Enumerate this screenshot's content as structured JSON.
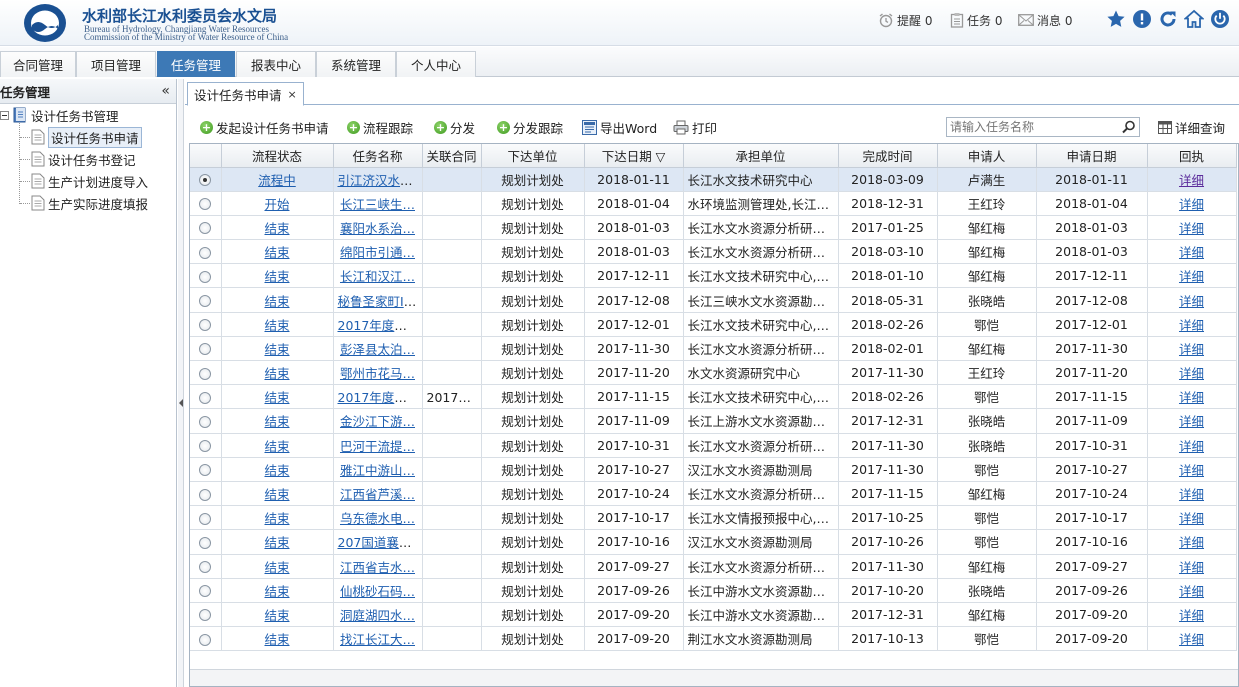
{
  "header": {
    "org_cn": "水利部长江水利委员会水文局",
    "org_en1": "Bureau  of  Hydrology,  Changjiang  Water  Resources",
    "org_en2": "Commission of the Ministry of Water Resource of China",
    "reminder_label": "提醒 0",
    "task_label": "任务 0",
    "message_label": "消息 0"
  },
  "menu": {
    "items": [
      "合同管理",
      "项目管理",
      "任务管理",
      "报表中心",
      "系统管理",
      "个人中心"
    ],
    "active": "任务管理"
  },
  "sidebar": {
    "title": "任务管理",
    "collapse_glyph": "«",
    "root": "设计任务书管理",
    "children": [
      "设计任务书申请",
      "设计任务书登记",
      "生产计划进度导入",
      "生产实际进度填报"
    ],
    "selected": "设计任务书申请"
  },
  "tab": {
    "label": "设计任务书申请",
    "close": "×"
  },
  "toolbar": {
    "start_label": "发起设计任务书申请",
    "track_label": "流程跟踪",
    "dispatch_label": "分发",
    "dispatch_track_label": "分发跟踪",
    "export_label": "导出Word",
    "print_label": "打印",
    "search_placeholder": "请输入任务名称",
    "detail_query_label": "详细查询"
  },
  "grid": {
    "columns": [
      "",
      "流程状态",
      "任务名称",
      "关联合同",
      "下达单位",
      "下达日期 ▽",
      "承担单位",
      "完成时间",
      "申请人",
      "申请日期",
      "回执"
    ],
    "rows": [
      [
        "流程中",
        "引江济汉水文…",
        "",
        "规划计划处",
        "2018-01-11",
        "长江水文技术研究中心",
        "2018-03-09",
        "卢满生",
        "2018-01-11",
        "详细"
      ],
      [
        "开始",
        "长江三峡生…",
        "",
        "规划计划处",
        "2018-01-04",
        "水环境监测管理处,长江…",
        "2018-12-31",
        "王红玲",
        "2018-01-04",
        "详细"
      ],
      [
        "结束",
        "襄阳水系治…",
        "",
        "规划计划处",
        "2018-01-03",
        "长江水文水资源分析研究…",
        "2017-01-25",
        "邹红梅",
        "2018-01-03",
        "详细"
      ],
      [
        "结束",
        "绵阳市引通…",
        "",
        "规划计划处",
        "2018-01-03",
        "长江水文水资源分析研究…",
        "2018-03-10",
        "邹红梅",
        "2018-01-03",
        "详细"
      ],
      [
        "结束",
        "长江和汉江…",
        "",
        "规划计划处",
        "2017-12-11",
        "长江水文技术研究中心,…",
        "2018-01-10",
        "邹红梅",
        "2017-12-11",
        "详细"
      ],
      [
        "结束",
        "秘鲁圣家町II…",
        "",
        "规划计划处",
        "2017-12-08",
        "长江三峡水文水资源勘测局",
        "2018-05-31",
        "张晓皓",
        "2017-12-08",
        "详细"
      ],
      [
        "结束",
        "2017年度长…",
        "",
        "规划计划处",
        "2017-12-01",
        "长江水文技术研究中心,…",
        "2018-02-26",
        "鄂恺",
        "2017-12-01",
        "详细"
      ],
      [
        "结束",
        "彭泽县太泊…",
        "",
        "规划计划处",
        "2017-11-30",
        "长江水文水资源分析研究…",
        "2018-02-01",
        "邹红梅",
        "2017-11-30",
        "详细"
      ],
      [
        "结束",
        "鄂州市花马…",
        "",
        "规划计划处",
        "2017-11-20",
        "水文水资源研究中心",
        "2017-11-30",
        "王红玲",
        "2017-11-20",
        "详细"
      ],
      [
        "结束",
        "2017年度长…",
        "2017年…",
        "规划计划处",
        "2017-11-15",
        "长江水文技术研究中心,…",
        "2018-02-26",
        "鄂恺",
        "2017-11-15",
        "详细"
      ],
      [
        "结束",
        "金沙江下游…",
        "",
        "规划计划处",
        "2017-11-09",
        "长江上游水文水资源勘测局",
        "2017-12-31",
        "张晓皓",
        "2017-11-09",
        "详细"
      ],
      [
        "结束",
        "巴河干流提…",
        "",
        "规划计划处",
        "2017-10-31",
        "长江水文水资源分析研究…",
        "2017-11-30",
        "张晓皓",
        "2017-10-31",
        "详细"
      ],
      [
        "结束",
        "雅江中游山…",
        "",
        "规划计划处",
        "2017-10-27",
        "汉江水文水资源勘测局",
        "2017-11-30",
        "鄂恺",
        "2017-10-27",
        "详细"
      ],
      [
        "结束",
        "江西省芦溪…",
        "",
        "规划计划处",
        "2017-10-24",
        "长江水文水资源分析研究…",
        "2017-11-15",
        "邹红梅",
        "2017-10-24",
        "详细"
      ],
      [
        "结束",
        "乌东德水电…",
        "",
        "规划计划处",
        "2017-10-17",
        "长江水文情报预报中心,…",
        "2017-10-25",
        "鄂恺",
        "2017-10-17",
        "详细"
      ],
      [
        "结束",
        "207国道襄阳…",
        "",
        "规划计划处",
        "2017-10-16",
        "汉江水文水资源勘测局",
        "2017-10-26",
        "鄂恺",
        "2017-10-16",
        "详细"
      ],
      [
        "结束",
        "江西省吉水…",
        "",
        "规划计划处",
        "2017-09-27",
        "长江水文水资源分析研究…",
        "2017-11-30",
        "邹红梅",
        "2017-09-27",
        "详细"
      ],
      [
        "结束",
        "仙桃砂石码…",
        "",
        "规划计划处",
        "2017-09-26",
        "长江中游水文水资源勘测局",
        "2017-10-20",
        "张晓皓",
        "2017-09-26",
        "详细"
      ],
      [
        "结束",
        "洞庭湖四水…",
        "",
        "规划计划处",
        "2017-09-20",
        "长江中游水文水资源勘测局",
        "2017-12-31",
        "邹红梅",
        "2017-09-20",
        "详细"
      ],
      [
        "结束",
        "找江长江大…",
        "",
        "规划计划处",
        "2017-09-20",
        "荆江水文水资源勘测局",
        "2017-10-13",
        "鄂恺",
        "2017-09-20",
        "详细"
      ]
    ]
  },
  "colors": {
    "accent": "#3d79b6",
    "brand": "#1a5092",
    "link": "#1f5fb0"
  }
}
